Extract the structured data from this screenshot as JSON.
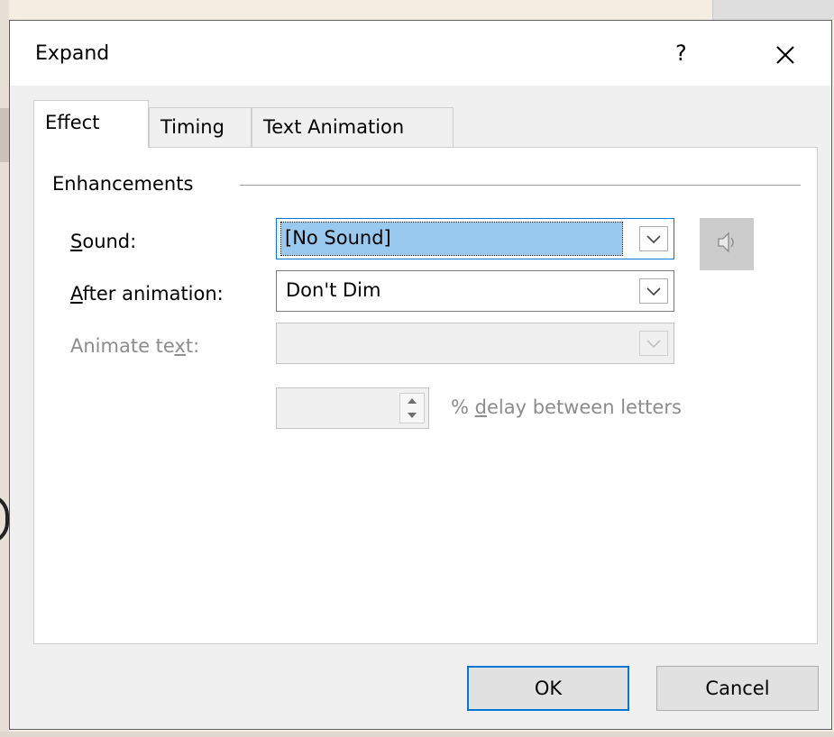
{
  "dialog": {
    "title": "Expand",
    "help_label": "?",
    "close_icon": "close-icon"
  },
  "tabs": [
    {
      "label": "Effect",
      "active": true
    },
    {
      "label": "Timing",
      "active": false
    },
    {
      "label": "Text Animation",
      "active": false
    }
  ],
  "enhancements": {
    "group_label": "Enhancements",
    "sound": {
      "label_access": "S",
      "label_rest": "ound:",
      "value": "[No Sound]"
    },
    "after_animation": {
      "label_access": "A",
      "label_rest": "fter animation:",
      "value": "Don't Dim"
    },
    "animate_text": {
      "label_pre": "Animate te",
      "label_access": "x",
      "label_post": "t:",
      "value": "",
      "disabled": true
    },
    "delay": {
      "value": "",
      "label_pre": "% ",
      "label_access": "d",
      "label_post": "elay between letters",
      "disabled": true
    },
    "speaker_icon": "speaker-icon"
  },
  "buttons": {
    "ok": "OK",
    "cancel": "Cancel"
  },
  "colors": {
    "selection": "#99c9ef",
    "focus_border": "#0078d7",
    "disabled_text": "#8c8c8c"
  }
}
